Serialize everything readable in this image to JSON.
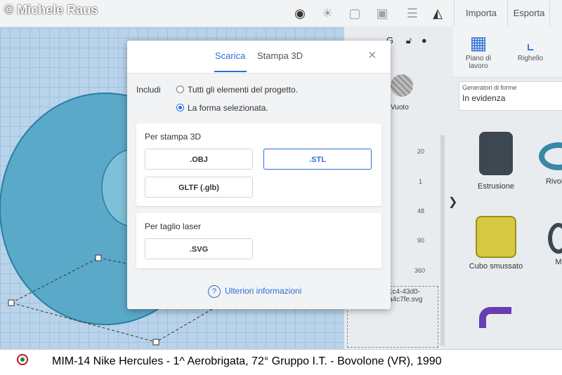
{
  "watermark": "© Michele Raus",
  "toolbar": {
    "import_label": "Importa",
    "export_label": "Esporta"
  },
  "right_panel": {
    "workplane_label": "Piano di lavoro",
    "ruler_label": "Righello",
    "generators_label": "Generatori di forme",
    "generators_value": "In evidenza",
    "shapes": [
      {
        "label": "Estrusione"
      },
      {
        "label": "Rivoluz"
      },
      {
        "label": "Cubo smussato"
      },
      {
        "label": "M"
      }
    ]
  },
  "inspector": {
    "hole_label": "Vuoto",
    "values": [
      "20",
      "1",
      "48",
      "90",
      "360"
    ],
    "file_line1": "1c4-43d0-",
    "file_line2": "a4c7fe.svg"
  },
  "modal": {
    "tabs": [
      {
        "label": "Scarica",
        "active": true
      },
      {
        "label": "Stampa 3D",
        "active": false
      }
    ],
    "close": "×",
    "include_label": "Includi",
    "options": [
      {
        "label": "Tutti gli elementi del progetto.",
        "checked": false
      },
      {
        "label": "La forma selezionata.",
        "checked": true
      }
    ],
    "print3d": {
      "title": "Per stampa 3D",
      "buttons": [
        ".OBJ",
        ".STL",
        "GLTF (.glb)"
      ],
      "selected": ".STL"
    },
    "laser": {
      "title": "Per taglio laser",
      "buttons": [
        ".SVG"
      ]
    },
    "more_info": "Ulteriori informazioni"
  },
  "caption": "MIM-14 Nike Hercules - 1^ Aerobrigata, 72° Gruppo I.T. - Bovolone (VR), 1990",
  "colors": {
    "accent": "#2c6fd6",
    "workplane": "#b9d3ea",
    "shape": "#5aa9c9"
  }
}
